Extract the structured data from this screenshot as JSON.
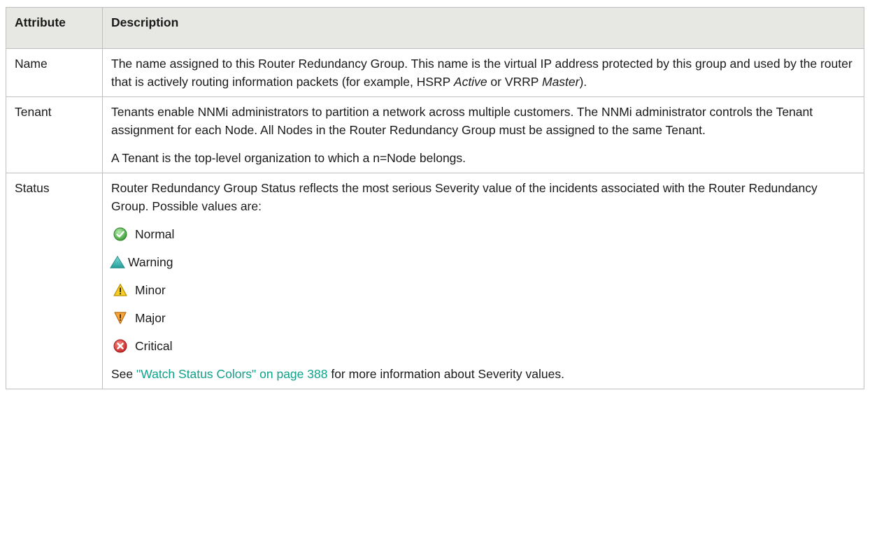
{
  "table": {
    "header": {
      "attribute": "Attribute",
      "description": "Description"
    },
    "rows": {
      "name": {
        "attribute": "Name",
        "desc_pre": "The name assigned to this Router Redundancy Group. This name is the virtual IP address protected by this group and used by the router that is actively routing information packets (for example, HSRP ",
        "desc_em1": "Active",
        "desc_mid": " or VRRP ",
        "desc_em2": "Master",
        "desc_post": ")."
      },
      "tenant": {
        "attribute": "Tenant",
        "para1": "Tenants enable NNMi administrators to partition a network across multiple customers. The NNMi administrator controls the Tenant assignment for each Node. All Nodes in the Router Redundancy Group must be assigned to the same Tenant.",
        "para2": "A Tenant is the top-level organization to which a n=Node belongs."
      },
      "status": {
        "attribute": "Status",
        "intro": "Router Redundancy Group Status reflects the most serious Severity value of the incidents associated with the Router Redundancy Group. Possible values are:",
        "severities": [
          {
            "label": "Normal",
            "icon": "normal-check-icon",
            "color": "#4caf50"
          },
          {
            "label": "Warning",
            "icon": "warning-triangle-icon",
            "color": "#3fb6b2"
          },
          {
            "label": "Minor",
            "icon": "minor-warning-icon",
            "color": "#f5c518"
          },
          {
            "label": "Major",
            "icon": "major-down-triangle-icon",
            "color": "#f29a2e"
          },
          {
            "label": "Critical",
            "icon": "critical-x-icon",
            "color": "#e53935"
          }
        ],
        "see_pre": "See ",
        "see_link": "\"Watch Status Colors\" on page 388",
        "see_post": " for more information about Severity values."
      }
    }
  },
  "colors": {
    "header_bg": "#e7e8e4",
    "border": "#bfbfbf",
    "link": "#0fa18b"
  }
}
